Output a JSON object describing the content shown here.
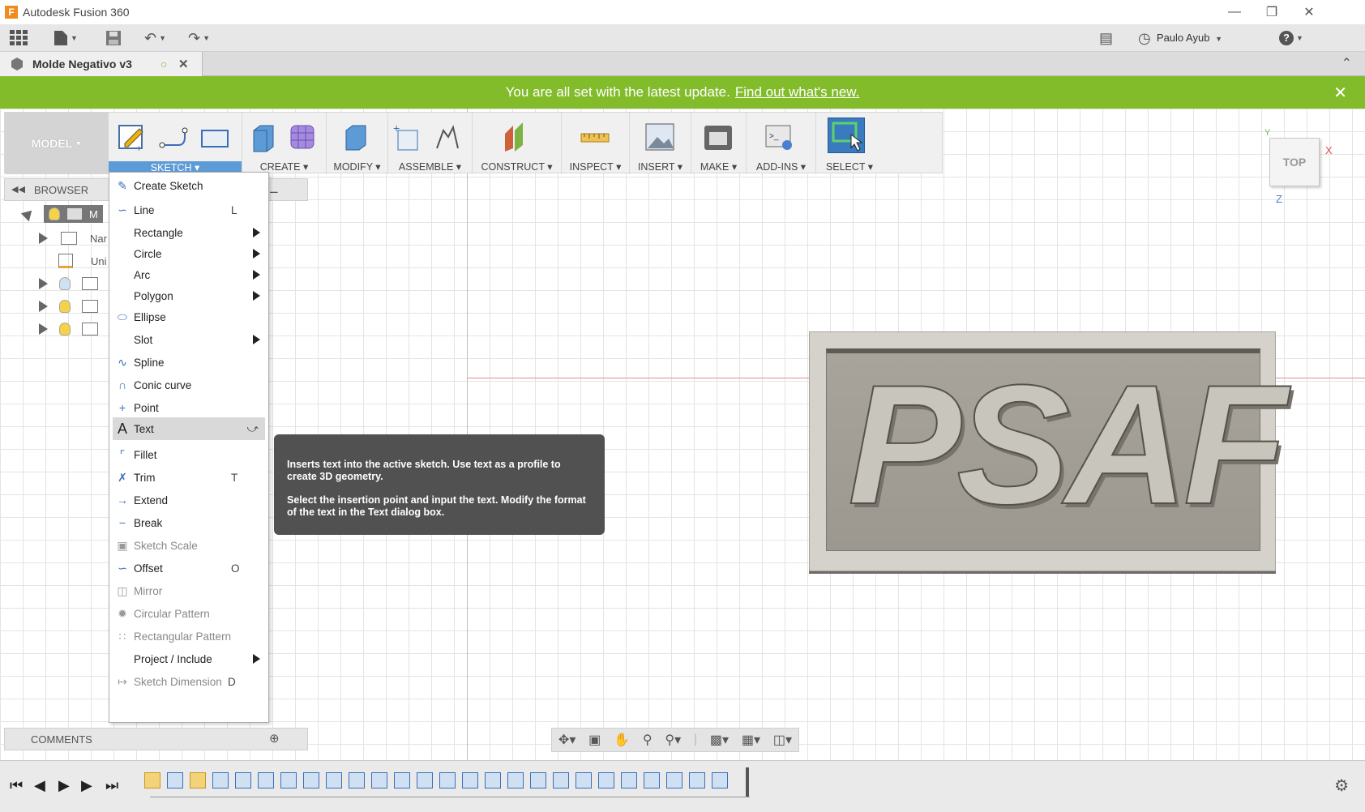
{
  "window": {
    "app_title": "Autodesk Fusion 360",
    "min_icon": "minimize-icon",
    "max_icon": "restore-icon",
    "close_icon": "close-icon"
  },
  "quick_access": {
    "user_name": "Paulo Ayub",
    "help_label": "?"
  },
  "document_tab": {
    "name": "Molde Negativo v3"
  },
  "banner": {
    "message": "You are all set with the latest update.",
    "link": "Find out what's new."
  },
  "toolbar": {
    "workspace": "MODEL",
    "groups": {
      "sketch": "SKETCH",
      "create": "CREATE",
      "modify": "MODIFY",
      "assemble": "ASSEMBLE",
      "construct": "CONSTRUCT",
      "inspect": "INSPECT",
      "insert": "INSERT",
      "make": "MAKE",
      "addins": "ADD-INS",
      "select": "SELECT"
    }
  },
  "browser": {
    "title": "BROWSER",
    "root_label": "M",
    "rows": [
      "Nar",
      "Uni"
    ]
  },
  "sketch_menu": {
    "items": [
      {
        "label": "Create Sketch",
        "shortcut": "",
        "icon": "create-sketch-icon"
      },
      {
        "label": "Line",
        "shortcut": "L",
        "icon": "line-icon"
      },
      {
        "label": "Rectangle",
        "shortcut": "",
        "icon": ""
      },
      {
        "label": "Circle",
        "shortcut": "",
        "icon": ""
      },
      {
        "label": "Arc",
        "shortcut": "",
        "icon": ""
      },
      {
        "label": "Polygon",
        "shortcut": "",
        "icon": ""
      },
      {
        "label": "Ellipse",
        "shortcut": "",
        "icon": "ellipse-icon"
      },
      {
        "label": "Slot",
        "shortcut": "",
        "icon": ""
      },
      {
        "label": "Spline",
        "shortcut": "",
        "icon": "spline-icon"
      },
      {
        "label": "Conic curve",
        "shortcut": "",
        "icon": "conic-curve-icon"
      },
      {
        "label": "Point",
        "shortcut": "",
        "icon": "point-icon"
      },
      {
        "label": "Text",
        "shortcut": "",
        "icon": "text-icon"
      },
      {
        "label": "Fillet",
        "shortcut": "",
        "icon": "fillet-icon"
      },
      {
        "label": "Trim",
        "shortcut": "T",
        "icon": "trim-icon"
      },
      {
        "label": "Extend",
        "shortcut": "",
        "icon": "extend-icon"
      },
      {
        "label": "Break",
        "shortcut": "",
        "icon": "break-icon"
      },
      {
        "label": "Sketch Scale",
        "shortcut": "",
        "icon": "sketch-scale-icon"
      },
      {
        "label": "Offset",
        "shortcut": "O",
        "icon": "offset-icon"
      },
      {
        "label": "Mirror",
        "shortcut": "",
        "icon": "mirror-icon"
      },
      {
        "label": "Circular Pattern",
        "shortcut": "",
        "icon": "circular-pattern-icon"
      },
      {
        "label": "Rectangular Pattern",
        "shortcut": "",
        "icon": "rectangular-pattern-icon"
      },
      {
        "label": "Project / Include",
        "shortcut": "",
        "icon": ""
      },
      {
        "label": "Sketch Dimension",
        "shortcut": "D",
        "icon": "sketch-dimension-icon"
      }
    ]
  },
  "tooltip": {
    "line1": "Inserts text into the active sketch. Use text as a profile to create 3D geometry.",
    "line2": "Select the insertion point and input the text. Modify the format of the text in the Text dialog box."
  },
  "comments": {
    "title": "COMMENTS"
  },
  "viewcube": {
    "face": "TOP",
    "axis_x": "X",
    "axis_y": "Y",
    "axis_z": "Z"
  },
  "model": {
    "text": "PSAF"
  }
}
